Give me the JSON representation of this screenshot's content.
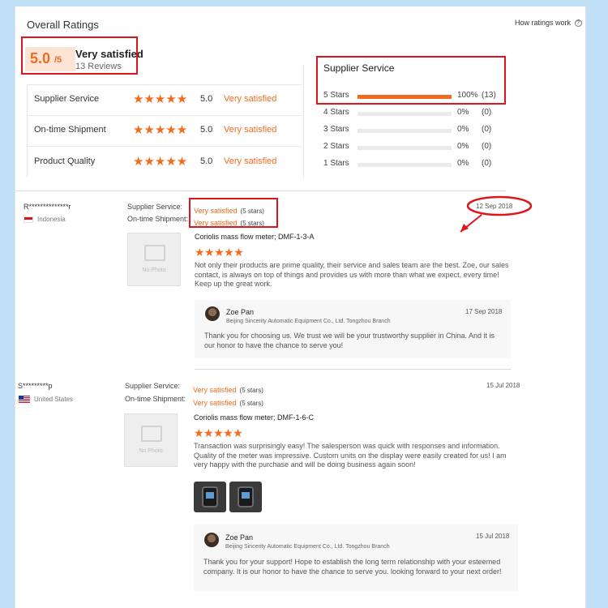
{
  "header": {
    "title": "Overall Ratings",
    "how_link": "How ratings work",
    "help_glyph": "?"
  },
  "summary": {
    "score": "5.0",
    "score_suffix": "/5",
    "label": "Very satisfied",
    "reviews": "13 Reviews"
  },
  "categories": [
    {
      "name": "Supplier Service",
      "stars": "★★★★★",
      "score": "5.0",
      "label": "Very satisfied"
    },
    {
      "name": "On-time Shipment",
      "stars": "★★★★★",
      "score": "5.0",
      "label": "Very satisfied"
    },
    {
      "name": "Product Quality",
      "stars": "★★★★★",
      "score": "5.0",
      "label": "Very satisfied"
    }
  ],
  "breakdown": {
    "title": "Supplier Service",
    "rows": [
      {
        "label": "5 Stars",
        "percent": "100%",
        "count": "(13)",
        "fill": 1.0
      },
      {
        "label": "4 Stars",
        "percent": "0%",
        "count": "(0)",
        "fill": 0
      },
      {
        "label": "3 Stars",
        "percent": "0%",
        "count": "(0)",
        "fill": 0
      },
      {
        "label": "2 Stars",
        "percent": "0%",
        "count": "(0)",
        "fill": 0
      },
      {
        "label": "1 Stars",
        "percent": "0%",
        "count": "(0)",
        "fill": 0
      }
    ]
  },
  "reviews": [
    {
      "reviewer": "R**************r",
      "country": "Indonesia",
      "supplier_label": "Supplier Service:",
      "supplier_value": "Very satisfied",
      "supplier_note": "(5 stars)",
      "shipment_label": "On-time Shipment:",
      "shipment_value": "Very satisfied",
      "shipment_note": "(5 stars)",
      "date": "12 Sep 2018",
      "no_photo": "No Photo",
      "product": "Coriolis mass flow meter; DMF-1-3-A",
      "stars": "★★★★★",
      "text": "Not only their products are prime quality, their service and sales team are the best. Zoe, our sales contact, is always on top of things and provides us with more than what we expect, every time! Keep up the great work.",
      "reply": {
        "name": "Zoe Pan",
        "company": "Beijing Sincerity Automatic Equipment Co., Ltd. Tongzhou Branch",
        "date": "17 Sep 2018",
        "text": "Thank you for choosing us. We trust we will be your trustworthy supplier in China. And it is our honor to have the chance to serve you!"
      }
    },
    {
      "reviewer": "S*********p",
      "country": "United States",
      "supplier_label": "Supplier Service:",
      "supplier_value": "Very satisfied",
      "supplier_note": "(5 stars)",
      "shipment_label": "On-time Shipment:",
      "shipment_value": "Very satisfied",
      "shipment_note": "(5 stars)",
      "date": "15 Jul 2018",
      "no_photo": "No Photo",
      "product": "Coriolis mass flow meter; DMF-1-6-C",
      "stars": "★★★★★",
      "text": "Transaction was surprisingly easy! The salesperson was quick with responses and information. Quality of the meter was impressive. Custom units on the display were easily created for us! I am very happy with the purchase and will be doing business again soon!",
      "reply": {
        "name": "Zoe Pan",
        "company": "Beijing Sincerity Automatic Equipment Co., Ltd. Tongzhou Branch",
        "date": "15 Jul 2018",
        "text": "Thank you for your support! Hope to establish the long term relationship with your esteemed company. It is our honor to have the chance to serve you. looking forward to your next order!"
      }
    }
  ],
  "colors": {
    "accent": "#f36c1e",
    "highlight_box": "#e0141e",
    "page_background": "#bfe0f6"
  }
}
